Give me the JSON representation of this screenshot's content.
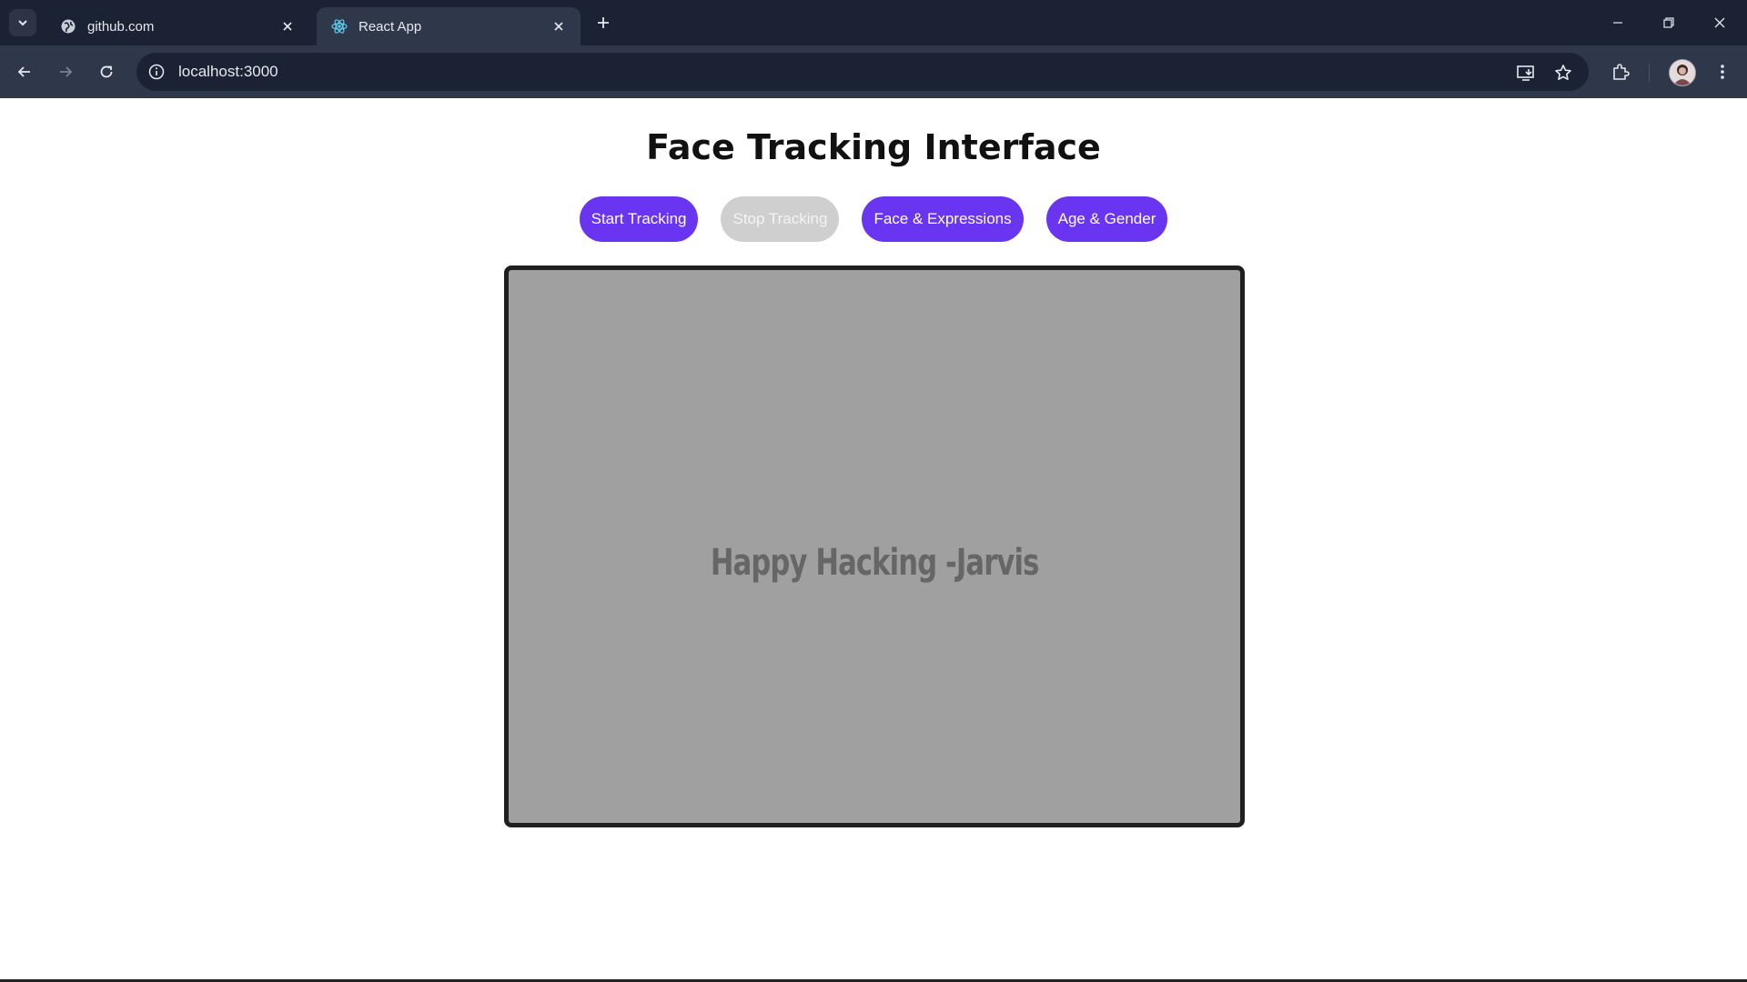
{
  "browser": {
    "tabs": [
      {
        "title": "github.com",
        "icon": "globe-icon",
        "active": false
      },
      {
        "title": "React App",
        "icon": "react-icon",
        "active": true
      }
    ],
    "url": "localhost:3000"
  },
  "page": {
    "heading": "Face Tracking Interface",
    "buttons": {
      "start": "Start Tracking",
      "stop": "Stop Tracking",
      "face_expressions": "Face & Expressions",
      "age_gender": "Age & Gender"
    },
    "video_text": "Happy Hacking -Jarvis"
  },
  "colors": {
    "accent": "#6a35f0",
    "disabled": "#cfcfcf",
    "video_bg": "#a0a0a0",
    "chrome_dark": "#1b2233",
    "chrome_toolbar": "#2f384b"
  }
}
